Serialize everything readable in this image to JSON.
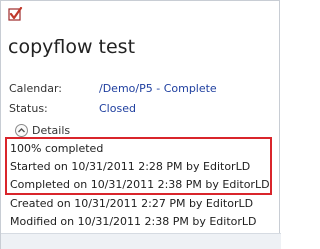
{
  "task": {
    "title": "copyflow test",
    "icons": {
      "status": "checkbox-checked-icon",
      "details_toggle": "chevron-up-circle-icon"
    },
    "colors": {
      "link": "#1f3f9f",
      "highlight": "#d9252b",
      "check": "#c0392b"
    }
  },
  "fields": {
    "calendar_label": "Calendar:",
    "calendar_value": "/Demo/P5 - Complete",
    "status_label": "Status:",
    "status_value": "Closed"
  },
  "details": {
    "toggle_label": "Details",
    "completion": "100% completed",
    "started": "Started on 10/31/2011 2:28 PM by EditorLD",
    "completed": "Completed on 10/31/2011 2:38 PM by EditorLD",
    "created": "Created on 10/31/2011 2:27 PM by EditorLD",
    "modified": "Modified on 10/31/2011 2:38 PM by EditorLD"
  }
}
